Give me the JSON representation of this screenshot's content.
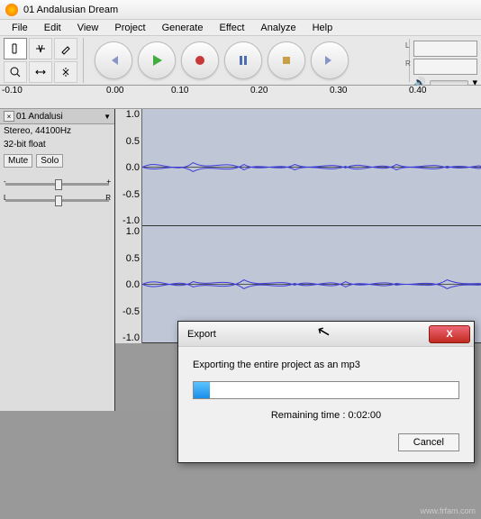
{
  "window": {
    "title": "01 Andalusian Dream"
  },
  "menu": {
    "file": "File",
    "edit": "Edit",
    "view": "View",
    "project": "Project",
    "generate": "Generate",
    "effect": "Effect",
    "analyze": "Analyze",
    "help": "Help"
  },
  "meters": {
    "left": "L",
    "right": "R"
  },
  "ruler": {
    "t0": "-0.10",
    "t1": "0.00",
    "t2": "0.10",
    "t3": "0.20",
    "t4": "0.30",
    "t5": "0.40"
  },
  "track": {
    "name": "01 Andalusi",
    "format": "Stereo, 44100Hz",
    "bits": "32-bit float",
    "mute": "Mute",
    "solo": "Solo",
    "gain_l": "-",
    "gain_r": "+",
    "pan_l": "L",
    "pan_r": "R",
    "scale": {
      "p10": "1.0",
      "p05": "0.5",
      "z": "0.0",
      "n05": "-0.5",
      "n10": "-1.0"
    }
  },
  "dialog": {
    "title": "Export",
    "message": "Exporting the entire project as an mp3",
    "remaining": "Remaining time : 0:02:00",
    "cancel": "Cancel"
  },
  "watermark": "www.frfam.com"
}
